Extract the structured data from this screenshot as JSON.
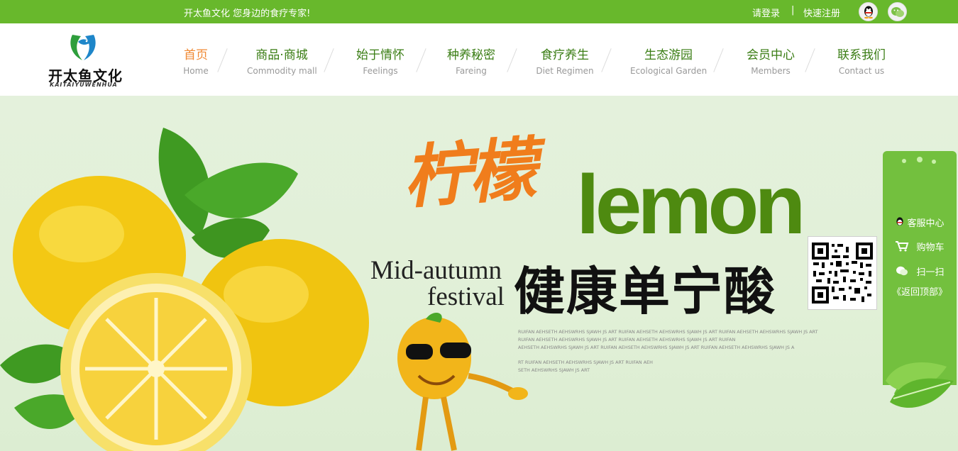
{
  "topbar": {
    "slogan": "开太鱼文化 您身边的食疗专家!",
    "login": "请登录",
    "separator": "|",
    "register": "快速注册",
    "icons": [
      "qq-icon",
      "wechat-icon"
    ],
    "bg_color": "#68b82c"
  },
  "logo": {
    "cn": "开太鱼文化",
    "en": "KAITAIYUWENHUA"
  },
  "nav": [
    {
      "cn": "首页",
      "en": "Home",
      "active": true
    },
    {
      "cn": "商品·商城",
      "en": "Commodity mall"
    },
    {
      "cn": "始于情怀",
      "en": "Feelings"
    },
    {
      "cn": "种养秘密",
      "en": "Fareing"
    },
    {
      "cn": "食疗养生",
      "en": "Diet Regimen"
    },
    {
      "cn": "生态游园",
      "en": "Ecological Garden"
    },
    {
      "cn": "会员中心",
      "en": "Members"
    },
    {
      "cn": "联系我们",
      "en": "Contact us"
    }
  ],
  "banner": {
    "cn_lemon": "柠檬",
    "lemon_word": "lemon",
    "mid_autumn": "Mid-autumn",
    "festival": "festival",
    "health": "健康单宁酸",
    "filler": [
      "RUIFAN AEHSETH  AEHSWRHS SJAWH JS ART  RUIFAN AEHSETH  AEHSWRHS SJAWH JS ART  RUIFAN AEHSETH  AEHSWRHS SJAWH JS ART",
      "RUIFAN AEHSETH  AEHSWRHS SJAWH JS ART  RUIFAN AEHSETH  AEHSWRHS SJAWH JS ART  RUIFAN",
      " AEHSETH  AEHSWRHS SJAWH JS ART  RUIFAN AEHSETH  AEHSWRHS SJAWH JS ART  RUIFAN AEHSETH  AEHSWRHS SJAWH JS A",
      "",
      "RT  RUIFAN AEHSETH  AEHSWRHS SJAWH JS ART  RUIFAN AEH",
      "SETH  AEHSWRHS SJAWH JS ART"
    ],
    "accent_orange": "#f07d1c",
    "accent_green": "#4e8a10"
  },
  "float_panel": {
    "service": "客服中心",
    "cart": "购物车",
    "scan": "扫一扫",
    "back_top": "《返回顶部》"
  }
}
